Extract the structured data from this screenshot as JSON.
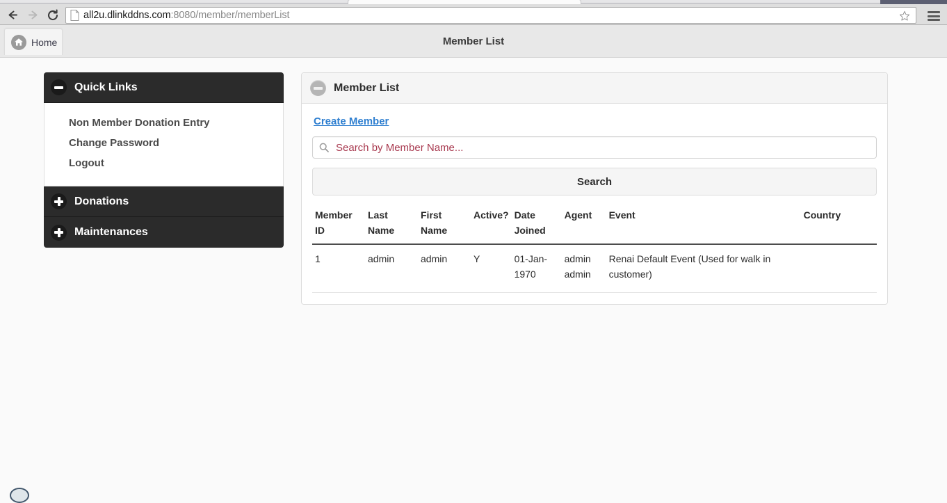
{
  "browser": {
    "url_host": "all2u.dlinkddns.com",
    "url_path": ":8080/member/memberList",
    "back_icon": "back-arrow-icon",
    "forward_icon": "forward-arrow-icon",
    "reload_icon": "reload-icon",
    "page_icon": "page-document-icon",
    "bookmark_icon": "star-icon",
    "menu_icon": "hamburger-menu-icon"
  },
  "header": {
    "home_label": "Home",
    "title": "Member List"
  },
  "sidebar": {
    "panels": [
      {
        "label": "Quick Links",
        "toggle": "minus",
        "expanded": true,
        "links": [
          "Non Member Donation Entry",
          "Change Password",
          "Logout"
        ]
      },
      {
        "label": "Donations",
        "toggle": "plus",
        "expanded": false,
        "links": []
      },
      {
        "label": "Maintenances",
        "toggle": "plus",
        "expanded": false,
        "links": []
      }
    ]
  },
  "main": {
    "panel_title": "Member List",
    "create_member_label": "Create Member",
    "search_placeholder": "Search by Member Name...",
    "search_value": "",
    "search_button_label": "Search",
    "table": {
      "columns": [
        "Member ID",
        "Last Name",
        "First Name",
        "Active?",
        "Date Joined",
        "Agent",
        "Event",
        "Country"
      ],
      "rows": [
        {
          "member_id": "1",
          "last_name": "admin",
          "first_name": "admin",
          "active": "Y",
          "date_joined": "01-Jan-1970",
          "agent": "admin admin",
          "event": "Renai Default Event (Used for walk in customer)",
          "country": ""
        }
      ]
    }
  },
  "colors": {
    "accordion_dark": "#2b2b2b",
    "link_blue": "#2f7fd0",
    "placeholder_red": "#a8394f",
    "page_bg": "#fafafa",
    "header_bar": "#e8e8e8"
  }
}
